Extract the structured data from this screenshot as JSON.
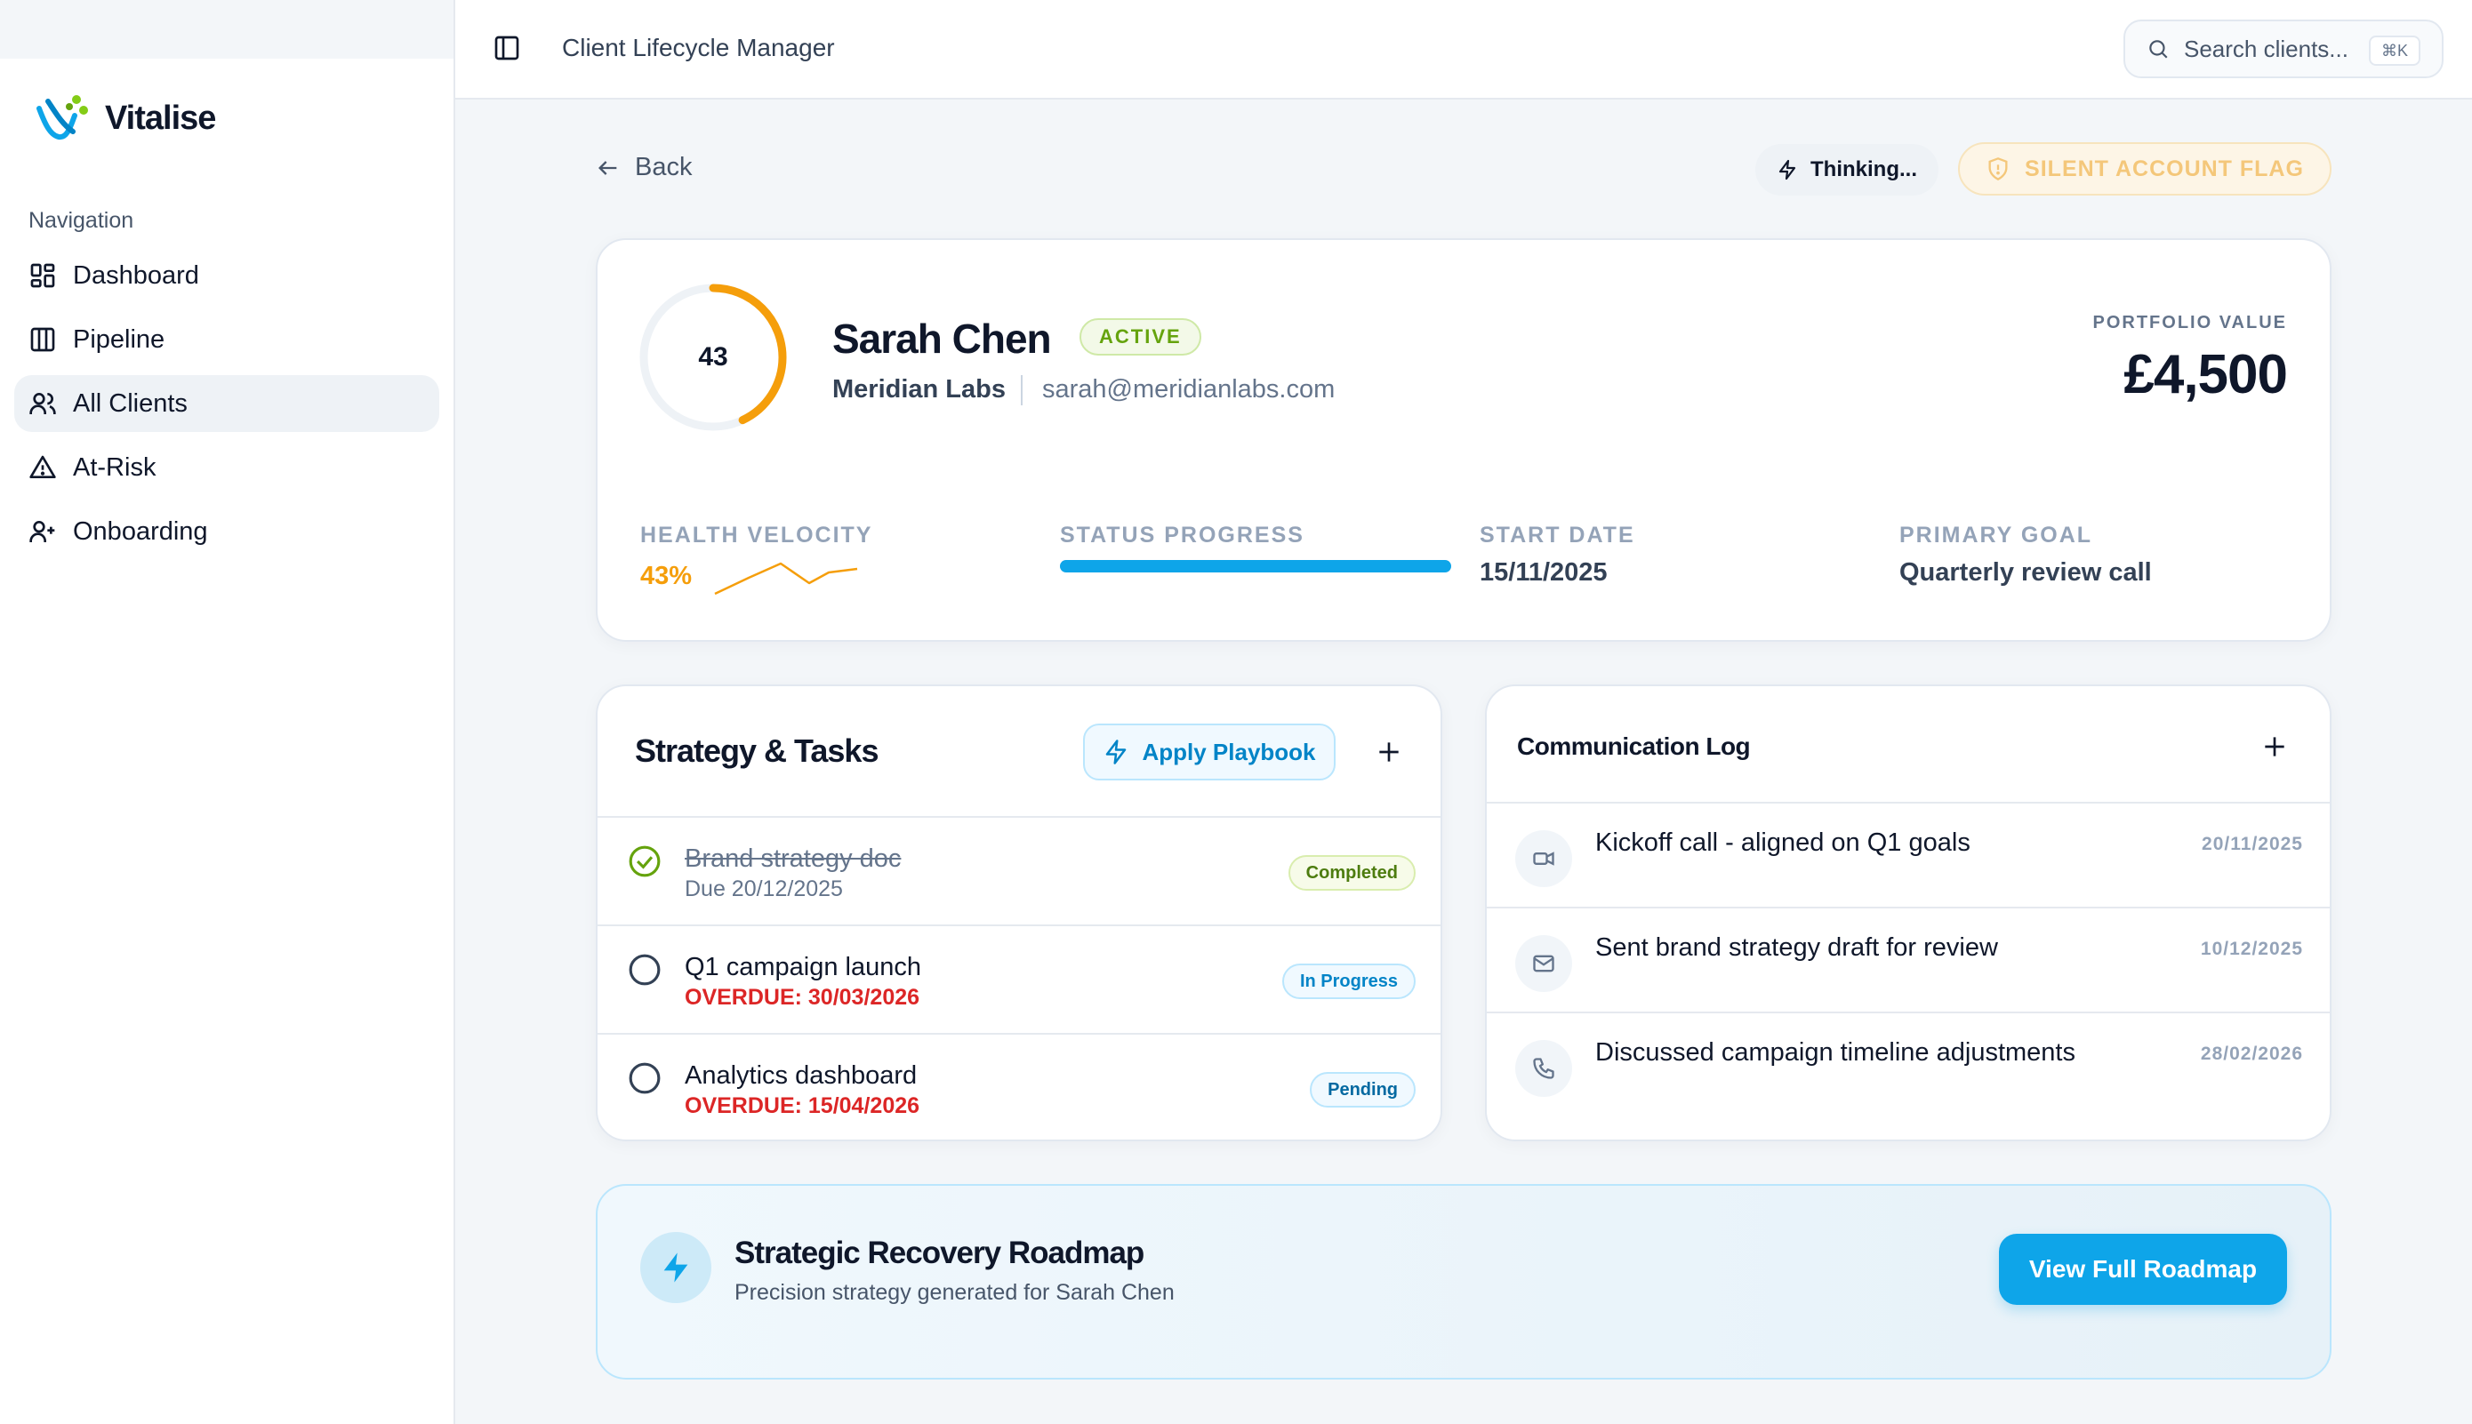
{
  "app": {
    "brand_name": "Vitalise",
    "title": "Client Lifecycle Manager"
  },
  "search": {
    "placeholder": "Search clients...",
    "shortcut": "⌘K"
  },
  "sidebar": {
    "heading": "Navigation",
    "items": [
      {
        "label": "Dashboard",
        "icon": "grid-icon"
      },
      {
        "label": "Pipeline",
        "icon": "columns-icon"
      },
      {
        "label": "All Clients",
        "icon": "users-icon",
        "active": true
      },
      {
        "label": "At-Risk",
        "icon": "warning-icon"
      },
      {
        "label": "Onboarding",
        "icon": "user-plus-icon"
      }
    ]
  },
  "toolbar": {
    "back_label": "Back",
    "thinking_label": "Thinking...",
    "flag_label": "SILENT ACCOUNT FLAG"
  },
  "client": {
    "health_score": "43",
    "health_fraction": 0.43,
    "name": "Sarah Chen",
    "status": "ACTIVE",
    "company": "Meridian Labs",
    "email": "sarah@meridianlabs.com",
    "portfolio_label": "PORTFOLIO VALUE",
    "portfolio_value": "£4,500"
  },
  "metrics": {
    "velocity_label": "HEALTH VELOCITY",
    "velocity_value": "43%",
    "progress_label": "STATUS PROGRESS",
    "progress_fraction": 1.0,
    "start_label": "START DATE",
    "start_value": "15/11/2025",
    "goal_label": "PRIMARY GOAL",
    "goal_value": "Quarterly review call"
  },
  "tasks": {
    "title": "Strategy & Tasks",
    "playbook_label": "Apply Playbook",
    "items": [
      {
        "title": "Brand strategy doc",
        "due": "Due 20/12/2025",
        "status": "Completed"
      },
      {
        "title": "Q1 campaign launch",
        "due": "OVERDUE: 30/03/2026",
        "status": "In Progress"
      },
      {
        "title": "Analytics dashboard",
        "due": "OVERDUE: 15/04/2026",
        "status": "Pending"
      }
    ]
  },
  "comms": {
    "title": "Communication Log",
    "items": [
      {
        "text": "Kickoff call - aligned on Q1 goals",
        "date": "20/11/2025",
        "icon": "video-icon"
      },
      {
        "text": "Sent brand strategy draft for review",
        "date": "10/12/2025",
        "icon": "mail-icon"
      },
      {
        "text": "Discussed campaign timeline adjustments",
        "date": "28/02/2026",
        "icon": "phone-icon"
      }
    ]
  },
  "roadmap": {
    "title": "Strategic Recovery Roadmap",
    "subtitle": "Precision strategy generated for Sarah Chen",
    "button_label": "View Full Roadmap"
  },
  "colors": {
    "accent": "#0ea5e9",
    "warning": "#f59e0b",
    "success": "#65a30d",
    "danger": "#dc2626"
  }
}
